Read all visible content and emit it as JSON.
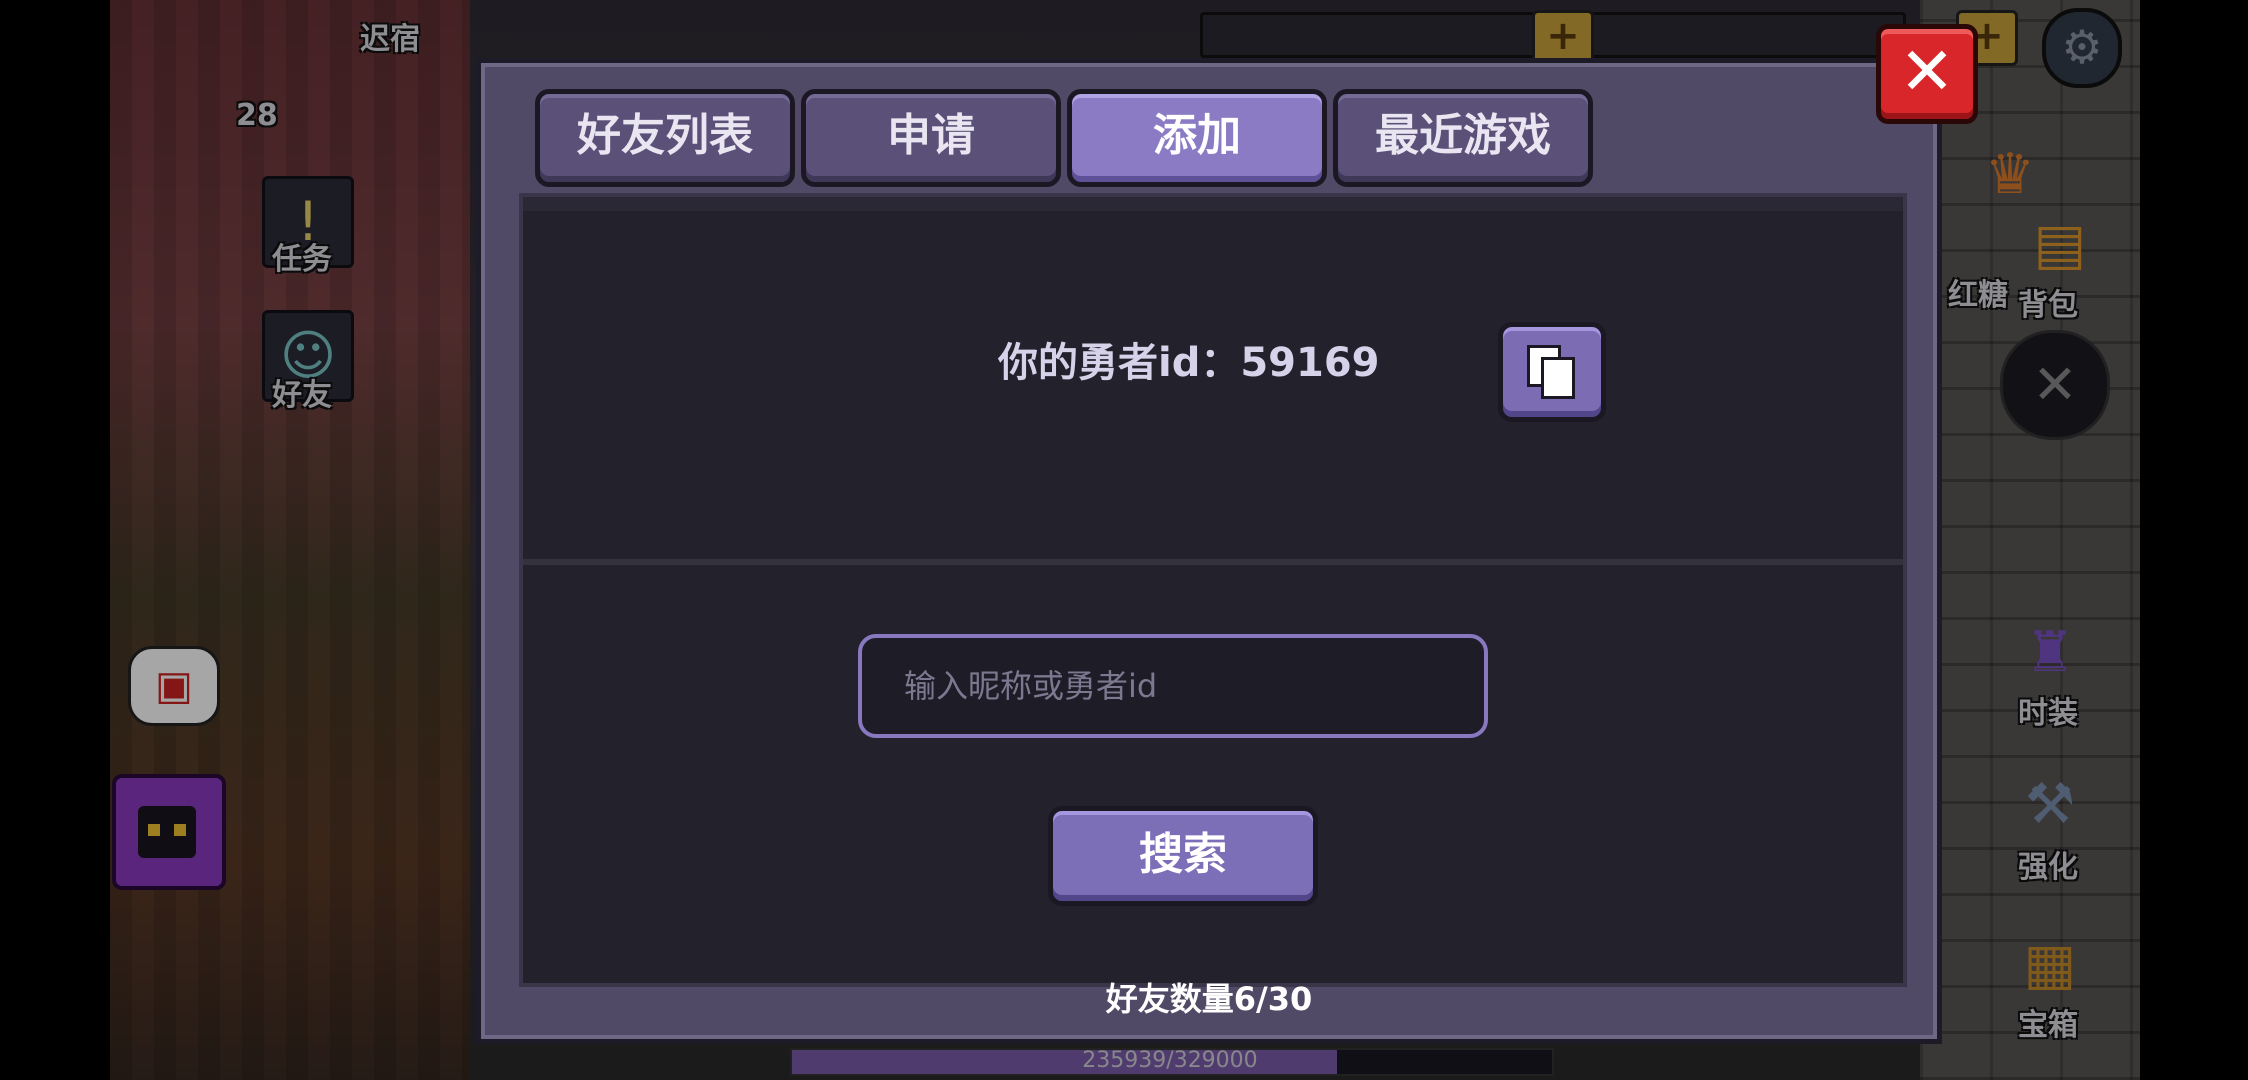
{
  "hud": {
    "dorm_label": "迟宿",
    "level": "28",
    "task_label": "任务",
    "friend_label": "好友",
    "hongtang_label": "红糖",
    "backpack_label": "背包",
    "fashion_label": "时装",
    "enhance_label": "强化",
    "chest_label": "宝箱",
    "xp_text": "235939/329000",
    "xp_progress": 0.717
  },
  "dialog": {
    "tabs": [
      {
        "label": "好友列表"
      },
      {
        "label": "申请"
      },
      {
        "label": "添加"
      },
      {
        "label": "最近游戏"
      }
    ],
    "active_tab": "添加",
    "id_label": "你的勇者id：",
    "id_value": "59169",
    "search_placeholder": "输入昵称或勇者id",
    "search_value": "",
    "search_button": "搜索",
    "friend_count": "好友数量6/30",
    "close_symbol": "✕"
  },
  "colors": {
    "dialog_bg": "#514a66",
    "content_bg": "#23212c",
    "button_purple": "#7d6eb8",
    "active_tab": "#8a7bc4",
    "close_red": "#d8262a"
  }
}
